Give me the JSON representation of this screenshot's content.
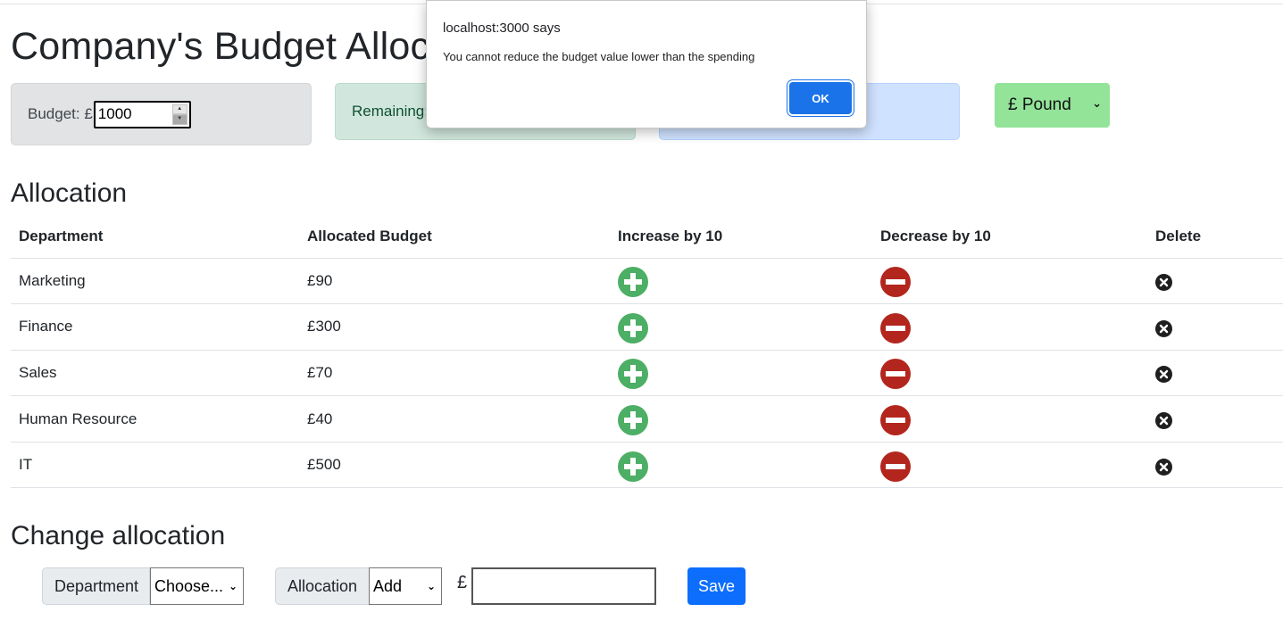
{
  "header": {
    "title": "Company's Budget Allocation"
  },
  "summary": {
    "budget_label": "Budget: £",
    "budget_value": "1000",
    "remaining_label": "Remaining:",
    "currency_value": "£ Pound"
  },
  "allocation": {
    "title": "Allocation",
    "columns": [
      "Department",
      "Allocated Budget",
      "Increase by 10",
      "Decrease by 10",
      "Delete"
    ],
    "rows": [
      {
        "department": "Marketing",
        "budget": "£90"
      },
      {
        "department": "Finance",
        "budget": "£300"
      },
      {
        "department": "Sales",
        "budget": "£70"
      },
      {
        "department": "Human Resource",
        "budget": "£40"
      },
      {
        "department": "IT",
        "budget": "£500"
      }
    ]
  },
  "change": {
    "title": "Change allocation",
    "department_label": "Department",
    "department_value": "Choose...",
    "allocation_label": "Allocation",
    "action_value": "Add",
    "currency_symbol": "£",
    "amount_value": "",
    "save_label": "Save"
  },
  "dialog": {
    "title": "localhost:3000 says",
    "message": "You cannot reduce the budget value lower than the spending",
    "ok_label": "OK"
  },
  "colors": {
    "increase": "#4caf65",
    "decrease": "#b3261e",
    "primary": "#0d6efd",
    "currency_bg": "#93e499"
  },
  "icons": {
    "increase": "plus-circle-icon",
    "decrease": "minus-circle-icon",
    "delete": "close-circle-icon"
  }
}
